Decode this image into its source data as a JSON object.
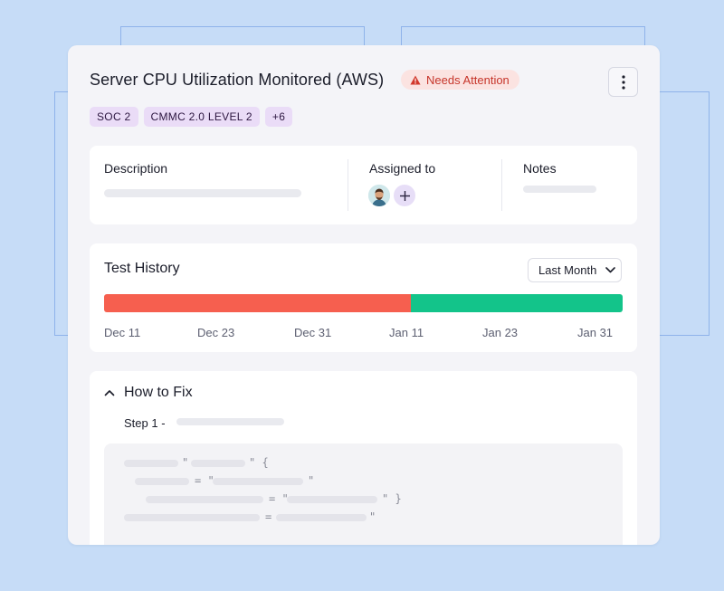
{
  "card": {
    "title": "Server CPU Utilization Monitored (AWS)",
    "status_badge": "Needs Attention",
    "tags": [
      "SOC 2",
      "CMMC 2.0 LEVEL 2",
      "+6"
    ]
  },
  "info": {
    "description_label": "Description",
    "assigned_label": "Assigned to",
    "notes_label": "Notes",
    "add_user_symbol": "+"
  },
  "history": {
    "title": "Test History",
    "range_selected": "Last Month",
    "fail_fraction": 0.592,
    "dates": [
      "Dec 11",
      "Dec 23",
      "Dec 31",
      "Jan 11",
      "Jan 23",
      "Jan 31"
    ]
  },
  "fix": {
    "title": "How to Fix",
    "step_label": "Step 1 -",
    "code_symbols": {
      "l1a": "\"",
      "l1b": "\" {",
      "l2a": "= \"",
      "l2b": "\"",
      "l3a": "= \"",
      "l3b": "\" }",
      "l4a": "=",
      "l4b": "\""
    }
  },
  "colors": {
    "background": "#c6dcf7",
    "badge_bg": "#fbe3e1",
    "badge_text": "#c6352a",
    "tag_bg": "#eadcf7",
    "bar_fail": "#f65f4f",
    "bar_pass": "#13c48a"
  },
  "icons": {
    "warning": "warning-triangle-icon",
    "menu": "kebab-menu-icon",
    "dropdown": "chevron-down-icon",
    "collapse": "chevron-up-icon",
    "add": "plus-icon"
  }
}
